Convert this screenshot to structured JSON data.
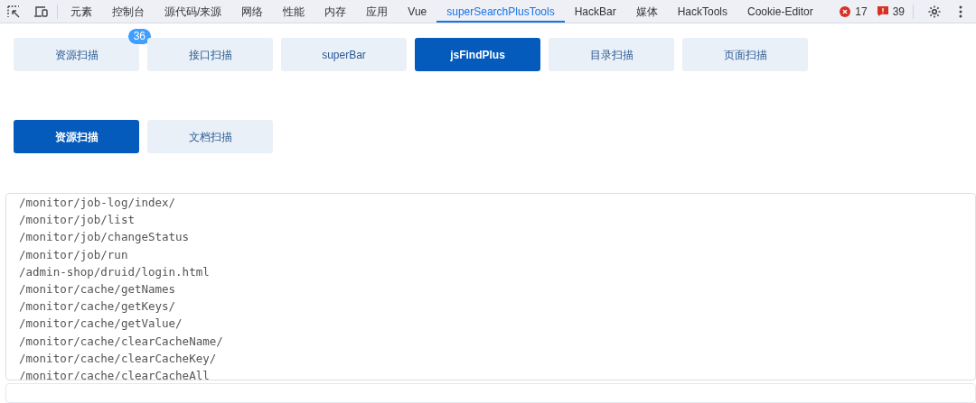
{
  "devtools_tabs": [
    {
      "label": "元素",
      "selected": false
    },
    {
      "label": "控制台",
      "selected": false
    },
    {
      "label": "源代码/来源",
      "selected": false
    },
    {
      "label": "网络",
      "selected": false
    },
    {
      "label": "性能",
      "selected": false
    },
    {
      "label": "内存",
      "selected": false
    },
    {
      "label": "应用",
      "selected": false
    },
    {
      "label": "Vue",
      "selected": false
    },
    {
      "label": "superSearchPlusTools",
      "selected": true
    },
    {
      "label": "HackBar",
      "selected": false
    },
    {
      "label": "媒体",
      "selected": false
    },
    {
      "label": "HackTools",
      "selected": false
    },
    {
      "label": "Cookie-Editor",
      "selected": false
    }
  ],
  "error_count": "17",
  "warning_count": "39",
  "tool_tabs": [
    {
      "label": "资源扫描",
      "selected": false,
      "badge": "36"
    },
    {
      "label": "接口扫描",
      "selected": false
    },
    {
      "label": "superBar",
      "selected": false
    },
    {
      "label": "jsFindPlus",
      "selected": true
    },
    {
      "label": "目录扫描",
      "selected": false
    },
    {
      "label": "页面扫描",
      "selected": false
    }
  ],
  "scan_tabs": [
    {
      "label": "资源扫描",
      "selected": true
    },
    {
      "label": "文档扫描",
      "selected": false
    }
  ],
  "results": [
    "/monitor/job-log/index/",
    "/monitor/job/list",
    "/monitor/job/changeStatus",
    "/monitor/job/run",
    "/admin-shop/druid/login.html",
    "/monitor/cache/getNames",
    "/monitor/cache/getKeys/",
    "/monitor/cache/getValue/",
    "/monitor/cache/clearCacheName/",
    "/monitor/cache/clearCacheKey/",
    "/monitor/cache/clearCacheAll"
  ]
}
